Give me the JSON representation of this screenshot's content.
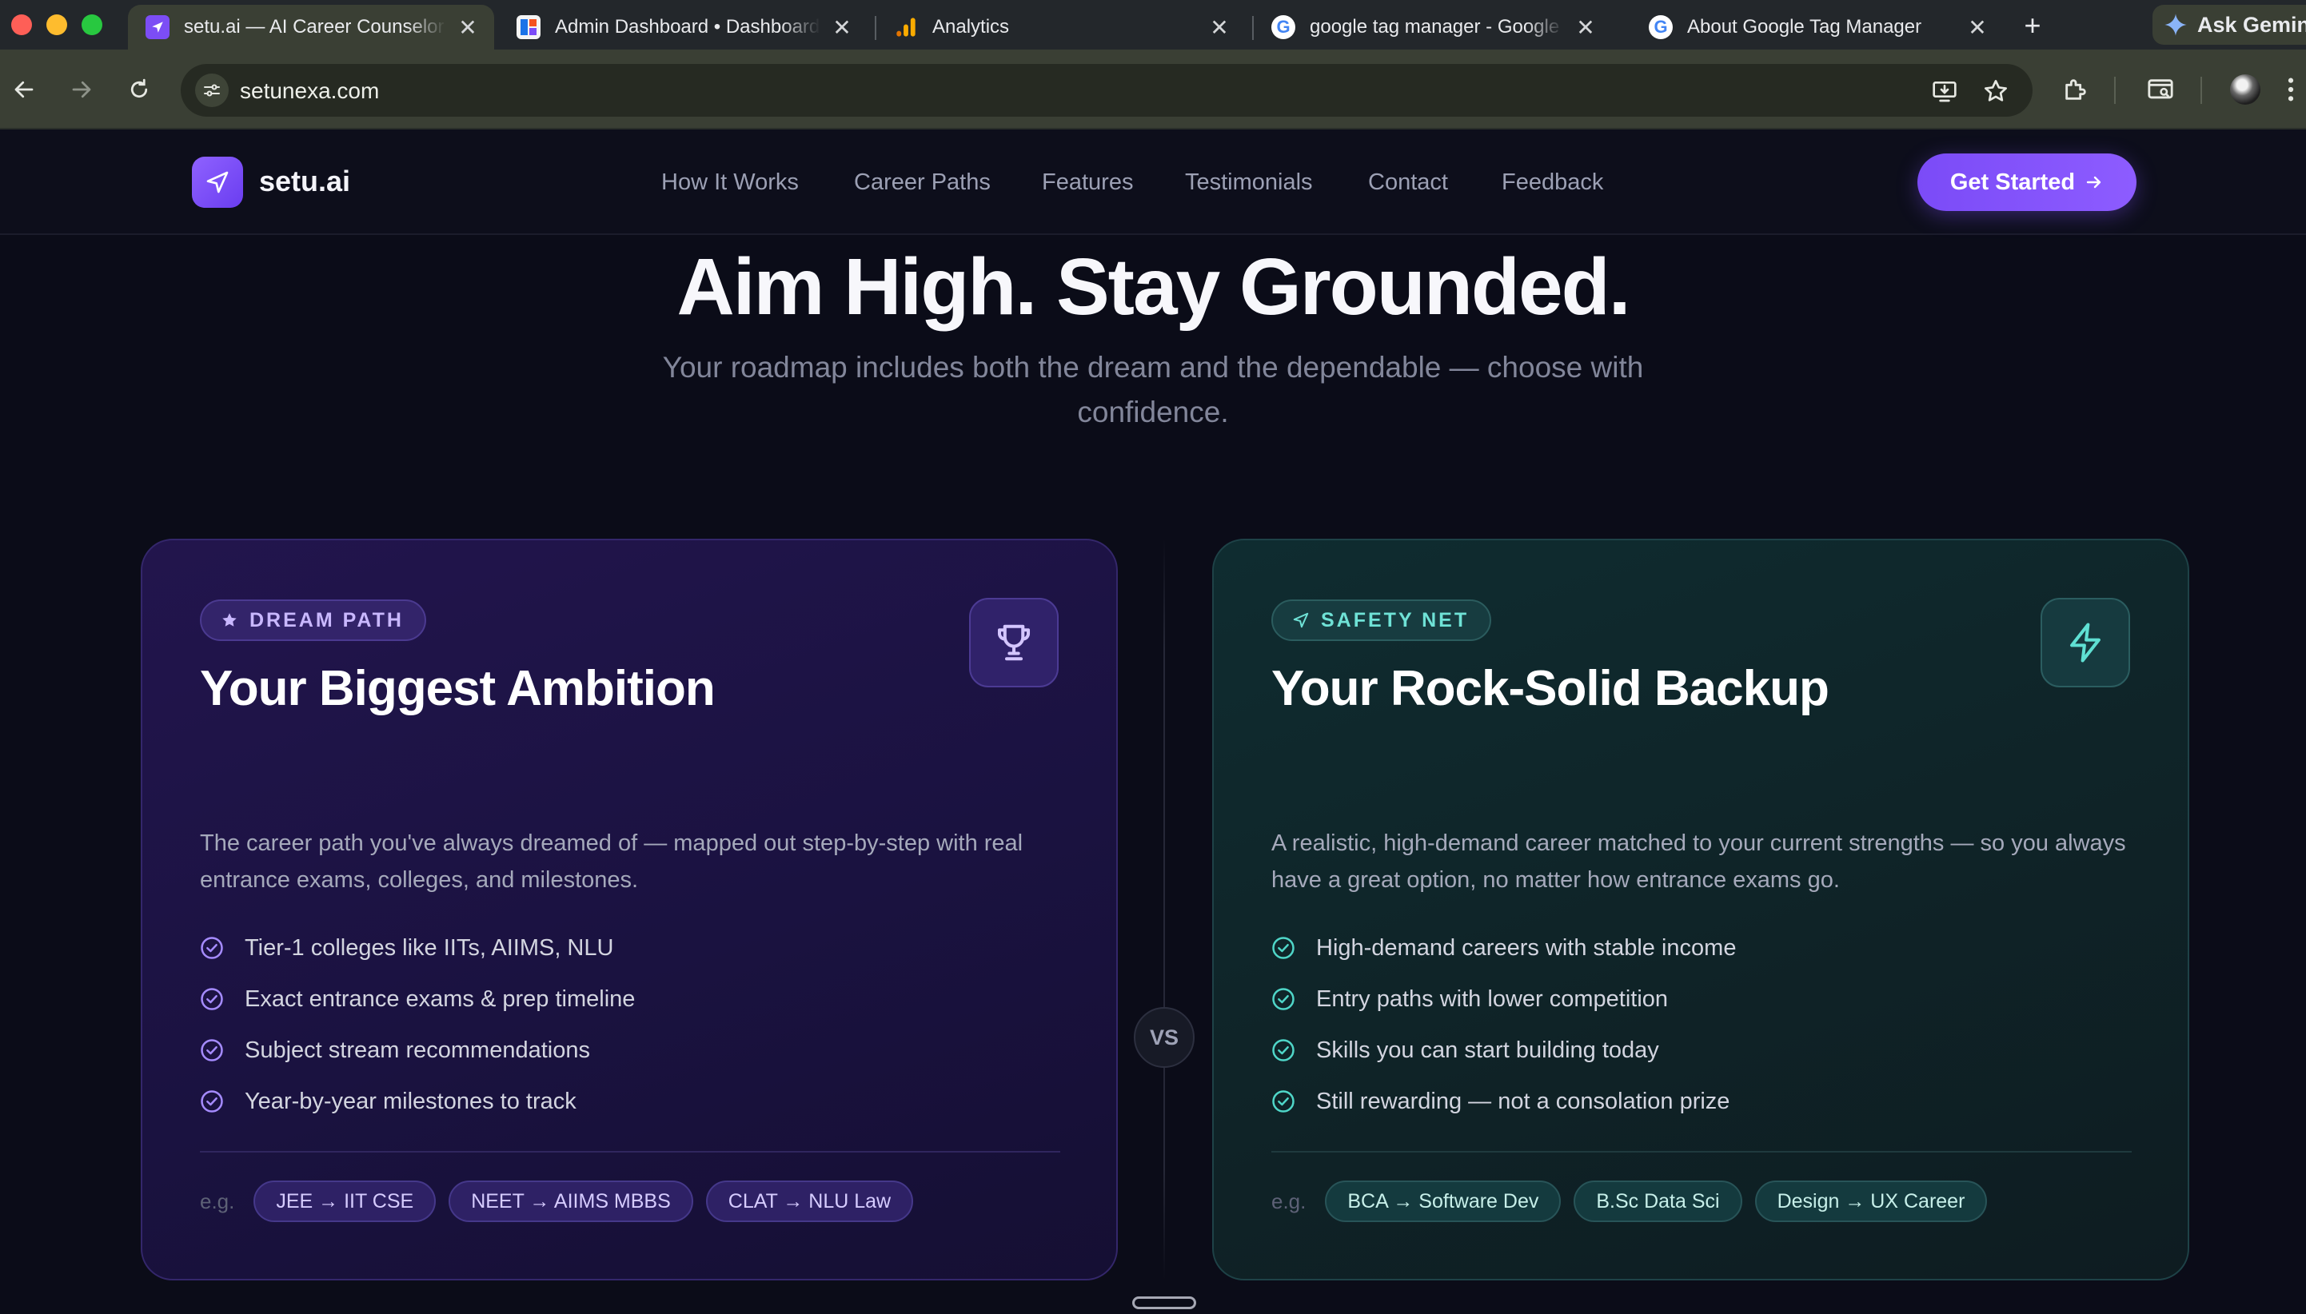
{
  "browser": {
    "tabs": [
      {
        "title": "setu.ai — AI Career Counselor",
        "active": true
      },
      {
        "title": "Admin Dashboard • Dashboard",
        "active": false
      },
      {
        "title": "Analytics",
        "active": false
      },
      {
        "title": "google tag manager - Google Search",
        "active": false
      },
      {
        "title": "About Google Tag Manager",
        "active": false
      }
    ],
    "gemini_label": "Ask Gemini",
    "url": "setunexa.com"
  },
  "nav": {
    "logo": "setu.ai",
    "links": [
      "How It Works",
      "Career Paths",
      "Features",
      "Testimonials",
      "Contact",
      "Feedback"
    ],
    "cta": "Get Started"
  },
  "hero": {
    "title": "Aim High. Stay Grounded.",
    "subtitle": "Your roadmap includes both the dream and the dependable — choose with confidence."
  },
  "dream": {
    "badge": "DREAM PATH",
    "title": "Your Biggest Ambition",
    "description": "The career path you've always dreamed of — mapped out step-by-step with real entrance exams, colleges, and milestones.",
    "features": [
      "Tier-1 colleges like IITs, AIIMS, NLU",
      "Exact entrance exams & prep timeline",
      "Subject stream recommendations",
      "Year-by-year milestones to track"
    ],
    "eg_label": "e.g.",
    "examples": [
      "JEE → IIT CSE",
      "NEET → AIIMS MBBS",
      "CLAT → NLU Law"
    ],
    "accent": "#8f62ff"
  },
  "vs_label": "VS",
  "safety": {
    "badge": "SAFETY NET",
    "title": "Your Rock-Solid Backup",
    "description": "A realistic, high-demand career matched to your current strengths — so you always have a great option, no matter how entrance exams go.",
    "features": [
      "High-demand careers with stable income",
      "Entry paths with lower competition",
      "Skills you can start building today",
      "Still rewarding — not a consolation prize"
    ],
    "eg_label": "e.g.",
    "examples": [
      "BCA → Software Dev",
      "B.Sc Data Sci",
      "Design → UX Career"
    ],
    "accent": "#4fd6c8"
  }
}
